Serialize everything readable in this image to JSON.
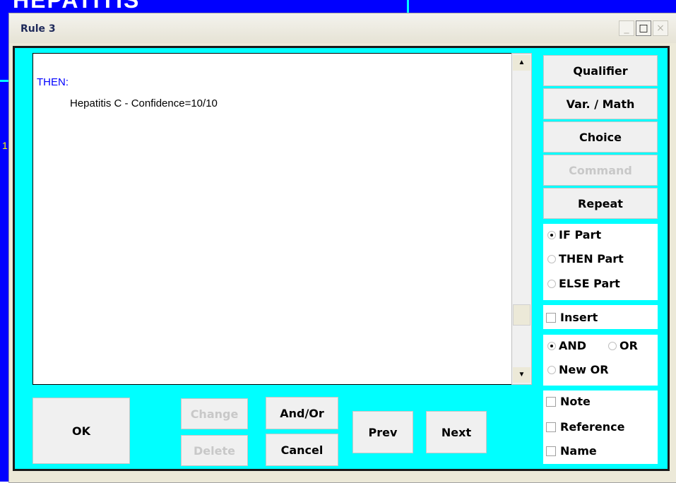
{
  "background_window": {
    "title_fragment": "HEPATITIS",
    "side_text": "1"
  },
  "dialog": {
    "title": "Rule 3",
    "controls": {
      "minimize": "_",
      "maximize": "□",
      "close": "×"
    }
  },
  "rule_text": {
    "then_label": "THEN:",
    "lines": [
      "Hepatitis C - Confidence=10/10"
    ]
  },
  "scrollbar": {
    "up": "▲",
    "down": "▼"
  },
  "right_buttons": {
    "qualifier": "Qualifier",
    "var_math": "Var. / Math",
    "choice": "Choice",
    "command": "Command",
    "repeat": "Repeat"
  },
  "part_options": {
    "selected": "IF Part",
    "if_part": "IF Part",
    "then_part": "THEN Part",
    "else_part": "ELSE Part"
  },
  "insert": {
    "label": "Insert",
    "checked": false
  },
  "logic_options": {
    "selected": "AND",
    "and": "AND",
    "or": "OR",
    "new_or": "New OR"
  },
  "extras": {
    "note": "Note",
    "reference": "Reference",
    "name": "Name"
  },
  "bottom_buttons": {
    "ok": "OK",
    "change": "Change",
    "delete": "Delete",
    "and_or": "And/Or",
    "cancel": "Cancel",
    "prev": "Prev",
    "next": "Next"
  },
  "colors": {
    "client_bg": "#00ffff",
    "then_label": "#0000ff",
    "background_app": "#0000ff"
  }
}
